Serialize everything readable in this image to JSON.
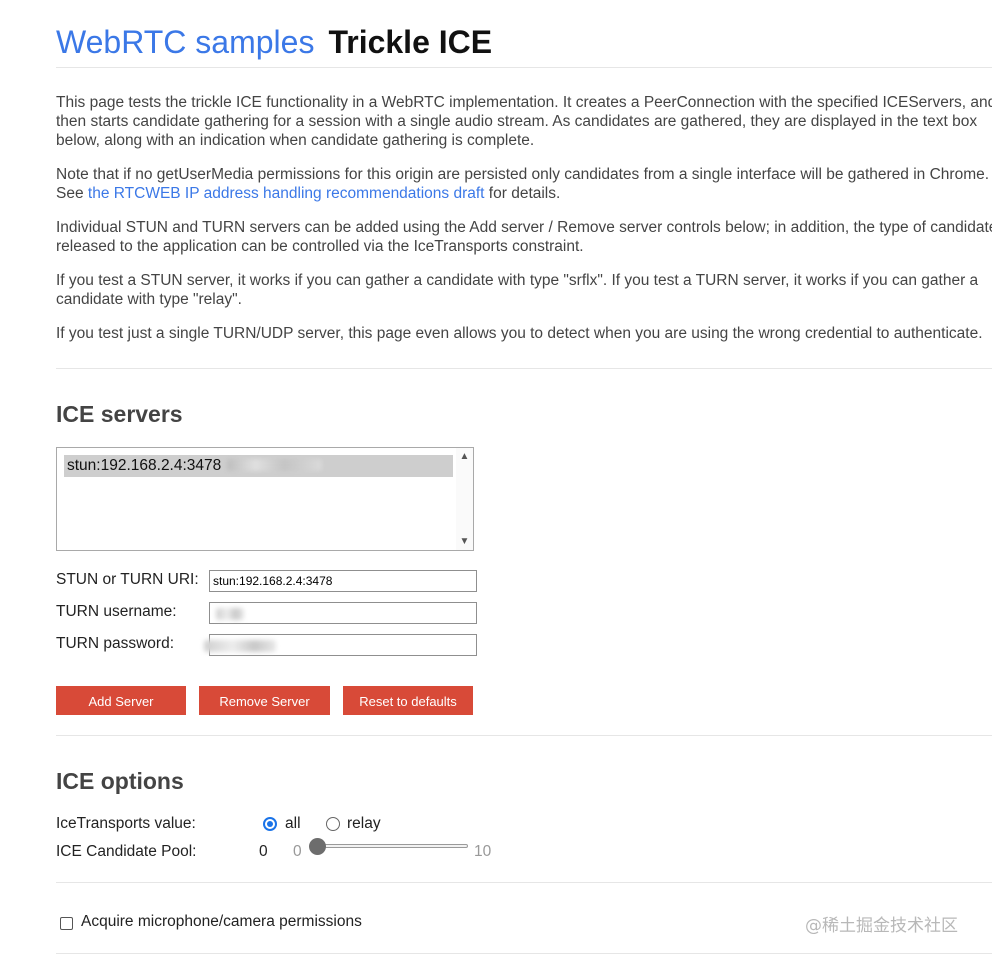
{
  "header": {
    "site_link": "WebRTC samples",
    "page_title": "Trickle ICE"
  },
  "intro": {
    "p1_line1": "This page tests the trickle ICE functionality in a WebRTC implementation. It creates a PeerConnection with the specified ICEServers, and",
    "p1_line2": "then starts candidate gathering for a session with a single audio stream. As candidates are gathered, they are displayed in the text box",
    "p1_line3": "below, along with an indication when candidate gathering is complete.",
    "p2_line1": "Note that if no getUserMedia permissions for this origin are persisted only candidates from a single interface will be gathered in Chrome.",
    "p2_see": "See ",
    "p2_link": "the RTCWEB IP address handling recommendations draft",
    "p2_after": " for details.",
    "p3_line1": "Individual STUN and TURN servers can be added using the Add server / Remove server controls below; in addition, the type of candidates",
    "p3_line2": "released to the application can be controlled via the IceTransports constraint.",
    "p4_line1": "If you test a STUN server, it works if you can gather a candidate with type \"srflx\". If you test a TURN server, it works if you can gather a",
    "p4_line2": "candidate with type \"relay\".",
    "p5_line1": "If you test just a single TURN/UDP server, this page even allows you to detect when you are using the wrong credential to authenticate."
  },
  "ice_servers": {
    "heading": "ICE servers",
    "servers": [
      "stun:192.168.2.4:3478"
    ],
    "uri_label": "STUN or TURN URI:",
    "uri_value": "stun:192.168.2.4:3478",
    "username_label": "TURN username:",
    "password_label": "TURN password:",
    "add_button": "Add Server",
    "remove_button": "Remove Server",
    "reset_button": "Reset to defaults"
  },
  "ice_options": {
    "heading": "ICE options",
    "transports_label": "IceTransports value:",
    "transport_all": "all",
    "transport_relay": "relay",
    "transports_selected": "all",
    "pool_label": "ICE Candidate Pool:",
    "pool_value": "0",
    "pool_min": "0",
    "pool_max": "10",
    "pool_fraction": 0
  },
  "permissions": {
    "label": "Acquire microphone/camera permissions",
    "checked": false
  },
  "watermark": "@稀土掘金技术社区",
  "colors": {
    "link": "#3b78e7",
    "button": "#d84a38",
    "radio": "#1a73e8"
  }
}
